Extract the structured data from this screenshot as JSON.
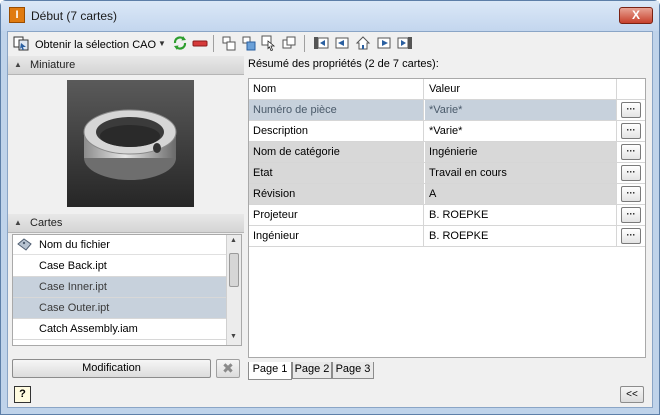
{
  "window": {
    "title": "Début (7 cartes)",
    "app_icon_letter": "I",
    "close_label": "X"
  },
  "toolbar": {
    "select_label": "Obtenir la sélection CAO",
    "select_arrow": "▼",
    "icons": [
      "select-cad-icon",
      "refresh-icon",
      "remove-icon",
      "copy-props-icon",
      "paste-props-icon",
      "pick-icon",
      "window-icon",
      "card-first-icon",
      "card-prev-icon",
      "card-home-icon",
      "card-next-icon",
      "card-last-icon"
    ]
  },
  "thumbnail_panel": {
    "header": "Miniature",
    "chevron": "▲"
  },
  "cards_panel": {
    "header": "Cartes",
    "chevron": "▲",
    "column_header": "Nom du fichier",
    "items": [
      {
        "label": "Case Back.ipt",
        "selected": false
      },
      {
        "label": "Case Inner.ipt",
        "selected": true
      },
      {
        "label": "Case Outer.ipt",
        "selected": true
      },
      {
        "label": "Catch Assembly.iam",
        "selected": false
      }
    ]
  },
  "actions": {
    "modify_label": "Modification",
    "cancel_label": "✖",
    "help_label": "?",
    "collapse_label": "<<"
  },
  "summary": {
    "title": "Résumé des propriétés (2 de 7 cartes):",
    "columns": [
      "Nom",
      "Valeur"
    ],
    "ellipsis_label": "···",
    "rows": [
      {
        "name": "Numéro de pièce",
        "value": "*Varie*",
        "style": "selected"
      },
      {
        "name": "Description",
        "value": "*Varie*",
        "style": "white"
      },
      {
        "name": "Nom de catégorie",
        "value": "Ingénierie",
        "style": "grey"
      },
      {
        "name": "Etat",
        "value": "Travail en cours",
        "style": "grey"
      },
      {
        "name": "Révision",
        "value": "A",
        "style": "grey"
      },
      {
        "name": "Projeteur",
        "value": "B. ROEPKE",
        "style": "white"
      },
      {
        "name": "Ingénieur",
        "value": "B. ROEPKE",
        "style": "white"
      }
    ]
  },
  "tabs": [
    {
      "label": "Page 1",
      "active": true
    },
    {
      "label": "Page 2",
      "active": false
    },
    {
      "label": "Page 3",
      "active": false
    }
  ],
  "colors": {
    "titlebar": "#c3d6ee",
    "selected_row": "#c7d1dc",
    "grey_row": "#d8d8d8",
    "close_button": "#c7402c"
  }
}
